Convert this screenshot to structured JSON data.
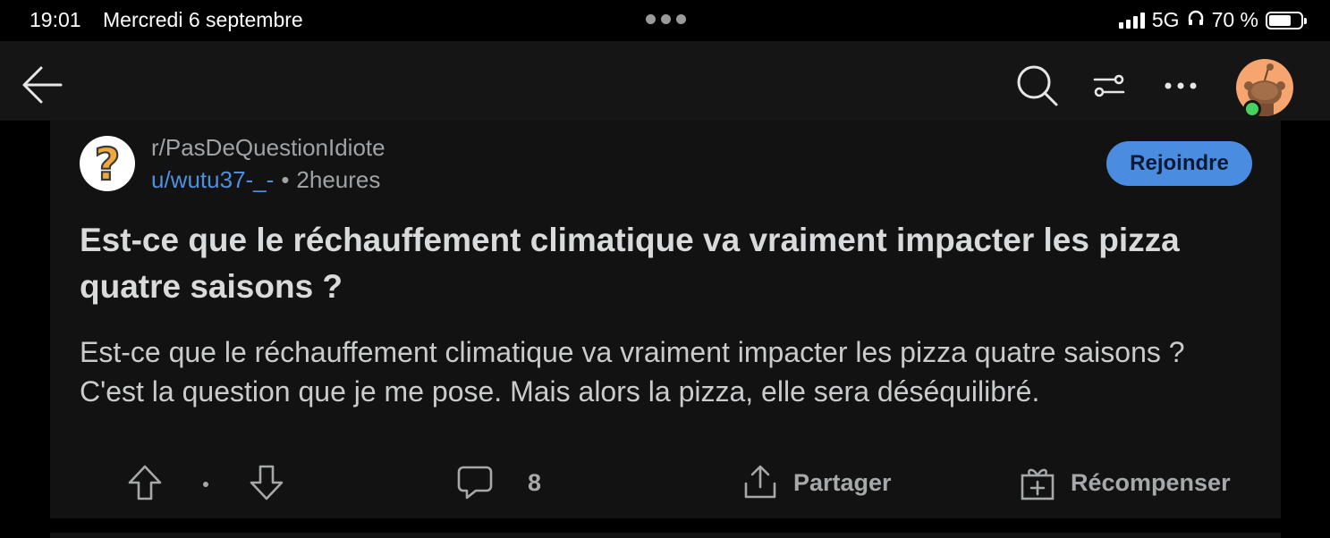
{
  "status_bar": {
    "time": "19:01",
    "date": "Mercredi 6 septembre",
    "network": "5G",
    "battery": "70 %",
    "battery_level": 0.7
  },
  "nav": {
    "icons": [
      "back-arrow-icon",
      "search-icon",
      "filter-icon",
      "more-icon",
      "avatar"
    ]
  },
  "post": {
    "subreddit": "r/PasDeQuestionIdiote",
    "author": "u/wutu37-_-",
    "separator": "•",
    "time_ago": "2heures",
    "join_label": "Rejoindre",
    "title": "Est-ce que le réchauffement climatique va vraiment impacter les pizza quatre saisons ?",
    "body": "Est-ce que le réchauffement climatique va vraiment impacter les pizza quatre saisons ? C'est la question que je me pose. Mais alors la pizza, elle sera déséquilibré.",
    "actions": {
      "comment_count": "8",
      "share_label": "Partager",
      "award_label": "Récompenser"
    }
  },
  "colors": {
    "background": "#000000",
    "nav_bg": "#151515",
    "card_bg": "#121212",
    "accent": "#4a8de0",
    "online": "#46d160"
  }
}
